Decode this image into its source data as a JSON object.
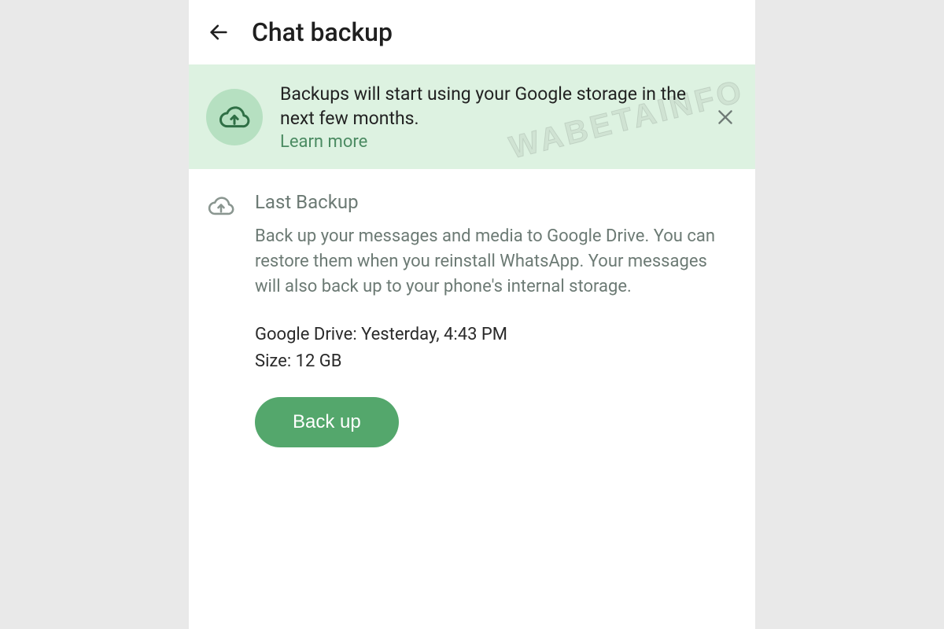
{
  "header": {
    "title": "Chat backup"
  },
  "banner": {
    "message": "Backups will start using your Google storage in the next few months.",
    "learn_more": "Learn more"
  },
  "section": {
    "title": "Last Backup",
    "description": "Back up your messages and media to Google Drive. You can restore them when you reinstall WhatsApp. Your messages will also back up to your phone's internal storage.",
    "drive_line": "Google Drive: Yesterday, 4:43 PM",
    "size_line": "Size: 12 GB",
    "button": "Back up"
  },
  "watermark": "WABETAINFO"
}
